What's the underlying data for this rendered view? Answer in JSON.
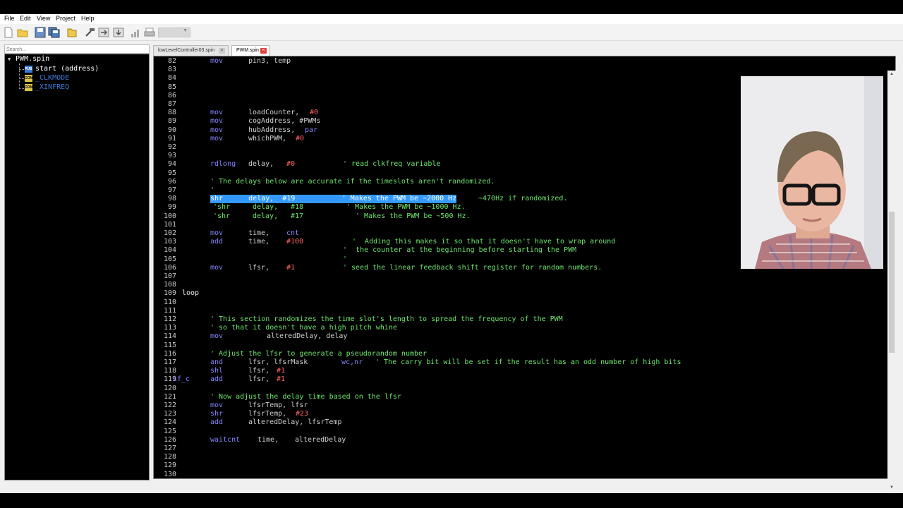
{
  "menu": {
    "file": "File",
    "edit": "Edit",
    "view": "View",
    "project": "Project",
    "help": "Help"
  },
  "toolbar": {
    "icons": [
      "new-file-icon",
      "open-folder-icon",
      "save-icon",
      "save-all-icon",
      "open-icon",
      "build-icon",
      "load-ram-icon",
      "load-eeprom-icon",
      "chart-icon",
      "print-icon"
    ]
  },
  "sidebar": {
    "search_placeholder": "Search...",
    "root": "PWM.spin",
    "items": [
      {
        "badge": "PUB",
        "label": "start (address)"
      },
      {
        "badge": "CON",
        "label": "_CLKMODE"
      },
      {
        "badge": "CON",
        "label": "_XINFREQ"
      }
    ]
  },
  "tabs": [
    {
      "label": "lowLevelController03.spin",
      "active": false
    },
    {
      "label": "PWM.spin",
      "active": true
    }
  ],
  "colors": {
    "keyword": "#8484ff",
    "number": "#ff6464",
    "comment": "#6ee36e",
    "text": "#d0d0d0",
    "selection": "#3399ff"
  },
  "code": [
    {
      "n": "82",
      "segs": [
        [
          "mov",
          "kw",
          80
        ],
        [
          "pin3, temp",
          "op",
          134
        ]
      ]
    },
    {
      "n": "83",
      "segs": []
    },
    {
      "n": "84",
      "segs": []
    },
    {
      "n": "85",
      "segs": []
    },
    {
      "n": "86",
      "segs": []
    },
    {
      "n": "87",
      "segs": []
    },
    {
      "n": "88",
      "segs": [
        [
          "mov",
          "kw",
          80
        ],
        [
          "loadCounter, ",
          "op",
          134
        ],
        [
          "#0",
          "num",
          221
        ]
      ]
    },
    {
      "n": "89",
      "segs": [
        [
          "mov",
          "kw",
          80
        ],
        [
          "cogAddress, #PWMs",
          "op",
          134
        ]
      ]
    },
    {
      "n": "90",
      "segs": [
        [
          "mov",
          "kw",
          80
        ],
        [
          "hubAddress, ",
          "op",
          134
        ],
        [
          "par",
          "kw",
          214
        ]
      ]
    },
    {
      "n": "91",
      "segs": [
        [
          "mov",
          "kw",
          80
        ],
        [
          "whichPWM, ",
          "op",
          134
        ],
        [
          "#0",
          "num",
          201
        ]
      ]
    },
    {
      "n": "92",
      "segs": []
    },
    {
      "n": "93",
      "segs": []
    },
    {
      "n": "94",
      "segs": [
        [
          "rdlong",
          "kw",
          80
        ],
        [
          "delay,",
          "op",
          134
        ],
        [
          "#0",
          "num",
          188
        ],
        [
          "' read clkfreq variable",
          "cm",
          268
        ]
      ]
    },
    {
      "n": "95",
      "segs": []
    },
    {
      "n": "96",
      "segs": [
        [
          "' The delays below are accurate if the timeslots aren't randomized.",
          "cm",
          80
        ]
      ]
    },
    {
      "n": "97",
      "segs": [
        [
          "'",
          "cm",
          80
        ]
      ]
    },
    {
      "n": "98",
      "segs": [
        [
          "shr      delay,  #19           ' Makes the PWM be ~2000 Hz",
          "sel",
          80
        ],
        [
          "~470Hz if randomized.",
          "cm",
          460
        ]
      ]
    },
    {
      "n": "99",
      "segs": [
        [
          "'shr",
          "cm",
          84
        ],
        [
          "delay,",
          "cm",
          140
        ],
        [
          "#18",
          "cm",
          194
        ],
        [
          "' Makes the PWM be ~1000 Hz.",
          "cm",
          273
        ]
      ]
    },
    {
      "n": "100",
      "segs": [
        [
          "'shr",
          "cm",
          84
        ],
        [
          "delay,",
          "cm",
          140
        ],
        [
          "#17",
          "cm",
          194
        ],
        [
          "' Makes the PWM be ~500 Hz.",
          "cm",
          286
        ]
      ]
    },
    {
      "n": "101",
      "segs": []
    },
    {
      "n": "102",
      "segs": [
        [
          "mov",
          "kw",
          80
        ],
        [
          "time,",
          "op",
          134
        ],
        [
          "cnt",
          "kw",
          188
        ]
      ]
    },
    {
      "n": "103",
      "segs": [
        [
          "add",
          "kw",
          80
        ],
        [
          "time,",
          "op",
          134
        ],
        [
          "#100",
          "num",
          188
        ],
        [
          "'  Adding this makes it so that it doesn't have to wrap around",
          "cm",
          281
        ]
      ]
    },
    {
      "n": "104",
      "segs": [
        [
          "'  the counter at the beginning before starting the PWM",
          "cm",
          268
        ]
      ]
    },
    {
      "n": "105",
      "segs": [
        [
          "'",
          "cm",
          268
        ]
      ]
    },
    {
      "n": "106",
      "segs": [
        [
          "mov",
          "kw",
          80
        ],
        [
          "lfsr,",
          "op",
          134
        ],
        [
          "#1",
          "num",
          188
        ],
        [
          "' seed the linear feedback shift register for random numbers.",
          "cm",
          268
        ]
      ]
    },
    {
      "n": "107",
      "segs": []
    },
    {
      "n": "108",
      "segs": []
    },
    {
      "n": "109",
      "segs": [
        [
          "loop",
          "lb",
          40
        ]
      ]
    },
    {
      "n": "110",
      "segs": []
    },
    {
      "n": "111",
      "segs": []
    },
    {
      "n": "112",
      "segs": [
        [
          "' This section randomizes the time slot's length to spread the frequency of the PWM",
          "cm",
          80
        ]
      ]
    },
    {
      "n": "113",
      "segs": [
        [
          "' so that it doesn't have a high pitch whine",
          "cm",
          80
        ]
      ]
    },
    {
      "n": "114",
      "segs": [
        [
          "mov",
          "kw",
          80
        ],
        [
          "alteredDelay, delay",
          "op",
          160
        ]
      ]
    },
    {
      "n": "115",
      "segs": []
    },
    {
      "n": "116",
      "segs": [
        [
          "' Adjust the lfsr to generate a pseudorandom number",
          "cm",
          80
        ]
      ]
    },
    {
      "n": "117",
      "segs": [
        [
          "and",
          "kw",
          80
        ],
        [
          "lfsr, lfsrMask",
          "op",
          134
        ],
        [
          "wc,nr",
          "kw",
          266
        ],
        [
          "' The carry bit will be set if the result has an odd number of high bits",
          "cm",
          314
        ]
      ]
    },
    {
      "n": "118",
      "segs": [
        [
          "shl",
          "kw",
          80
        ],
        [
          "lfsr, ",
          "op",
          134
        ],
        [
          "#1",
          "num",
          174
        ]
      ]
    },
    {
      "n": "119",
      "segs": [
        [
          "if_c",
          "cond",
          27
        ],
        [
          "add",
          "kw",
          80
        ],
        [
          "lfsr, ",
          "op",
          134
        ],
        [
          "#1",
          "num",
          174
        ]
      ]
    },
    {
      "n": "120",
      "segs": []
    },
    {
      "n": "121",
      "segs": [
        [
          "' Now adjust the delay time based on the lfsr",
          "cm",
          80
        ]
      ]
    },
    {
      "n": "122",
      "segs": [
        [
          "mov",
          "kw",
          80
        ],
        [
          "lfsrTemp, lfsr",
          "op",
          134
        ]
      ]
    },
    {
      "n": "123",
      "segs": [
        [
          "shr",
          "kw",
          80
        ],
        [
          "lfsrTemp, ",
          "op",
          134
        ],
        [
          "#23",
          "num",
          201
        ]
      ]
    },
    {
      "n": "124",
      "segs": [
        [
          "add",
          "kw",
          80
        ],
        [
          "alteredDelay, lfsrTemp",
          "op",
          134
        ]
      ]
    },
    {
      "n": "125",
      "segs": []
    },
    {
      "n": "126",
      "segs": [
        [
          "waitcnt",
          "kw",
          80
        ],
        [
          "time,",
          "op",
          147
        ],
        [
          "alteredDelay",
          "op",
          200
        ]
      ]
    },
    {
      "n": "127",
      "segs": []
    },
    {
      "n": "128",
      "segs": []
    },
    {
      "n": "129",
      "segs": []
    },
    {
      "n": "130",
      "segs": []
    }
  ]
}
